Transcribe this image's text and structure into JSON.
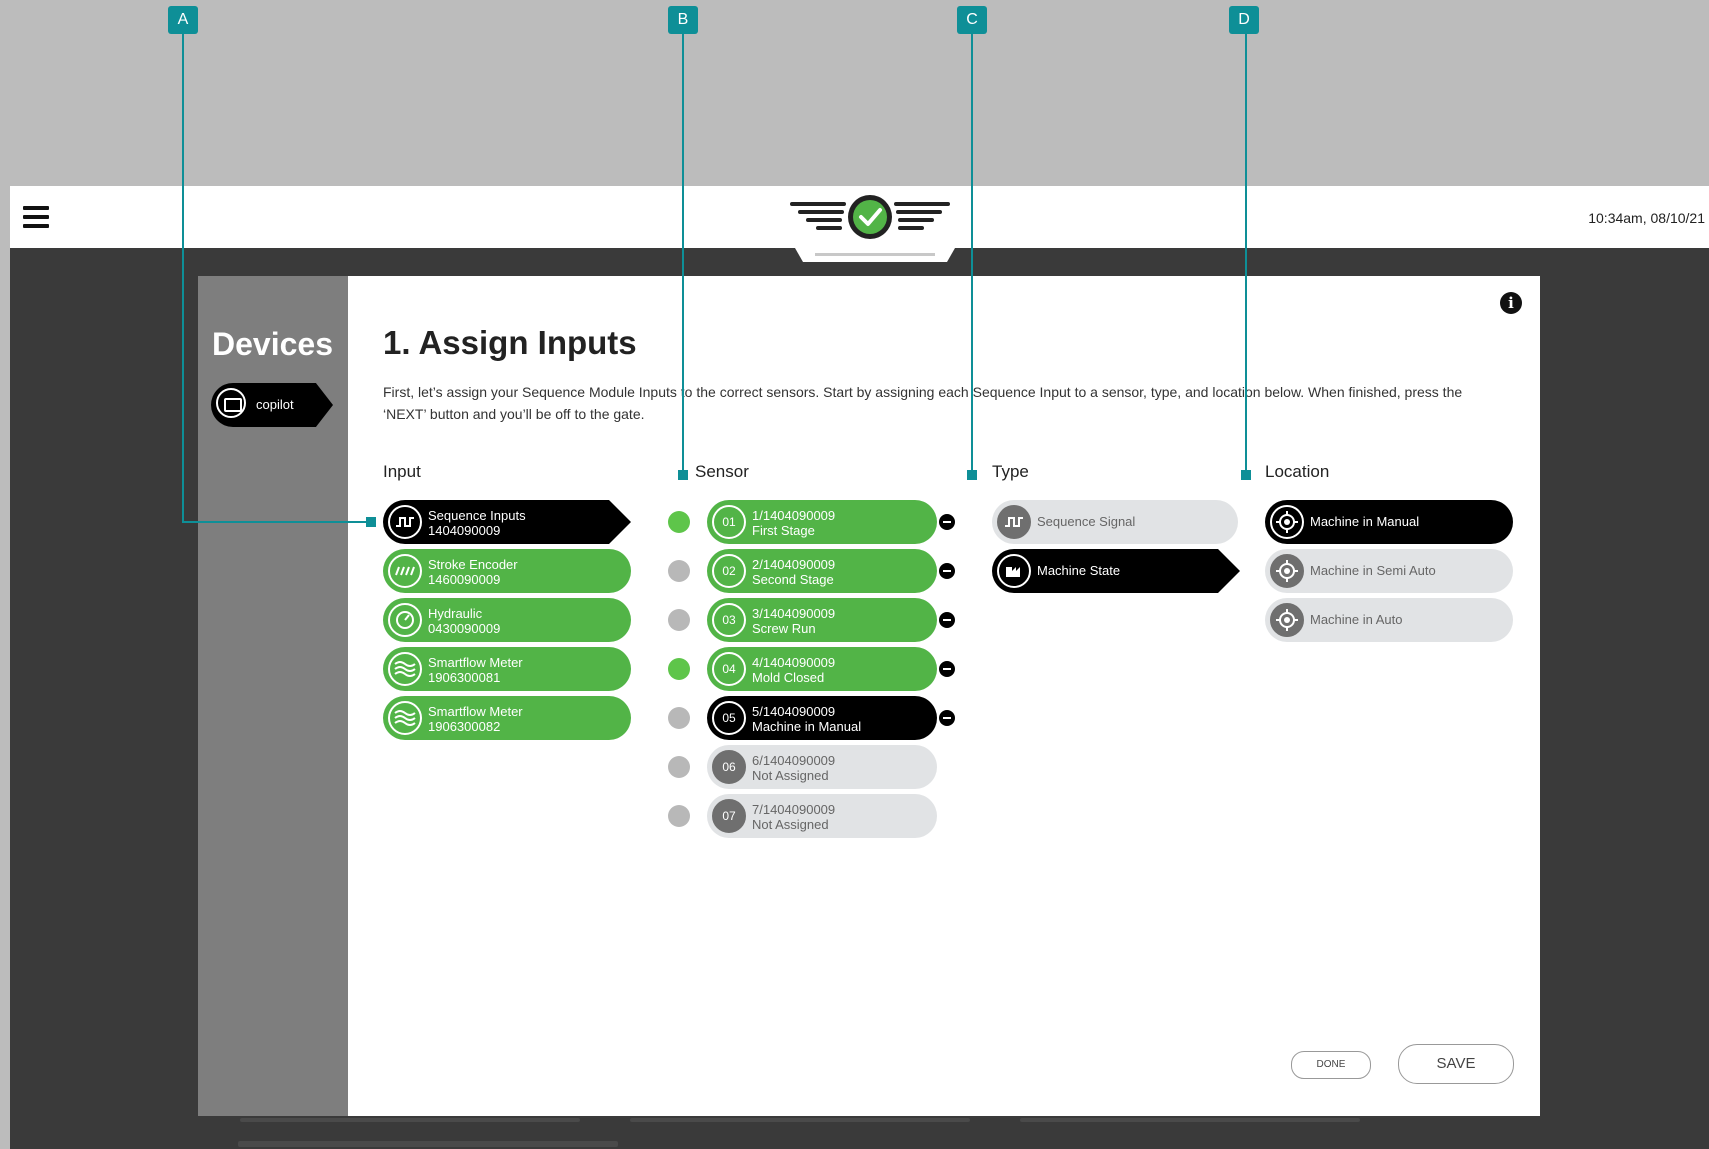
{
  "header": {
    "clock": "10:34am, 08/10/21"
  },
  "sidebar": {
    "title": "Devices",
    "device_label": "copilot"
  },
  "main": {
    "title": "1. Assign Inputs",
    "intro": "First, let’s assign your Sequence Module Inputs to the correct sensors. Start by assigning each Sequence Input to a sensor, type, and location below. When finished, press the ‘NEXT’ button and you’ll be off to the gate."
  },
  "columns": {
    "input": "Input",
    "sensor": "Sensor",
    "type": "Type",
    "location": "Location"
  },
  "inputs": [
    {
      "name": "Sequence Inputs",
      "serial": "1404090009",
      "icon": "square-wave-icon",
      "state": "selected"
    },
    {
      "name": "Stroke Encoder",
      "serial": "1460090009",
      "icon": "encoder-icon",
      "state": "assigned"
    },
    {
      "name": "Hydraulic",
      "serial": "0430090009",
      "icon": "gauge-icon",
      "state": "assigned"
    },
    {
      "name": "Smartflow Meter",
      "serial": "1906300081",
      "icon": "wave-icon",
      "state": "assigned"
    },
    {
      "name": "Smartflow Meter",
      "serial": "1906300082",
      "icon": "wave-icon",
      "state": "assigned"
    }
  ],
  "sensors": [
    {
      "num": "01",
      "id": "1/1404090009",
      "label": "First Stage",
      "state": "assigned",
      "indicator": "on"
    },
    {
      "num": "02",
      "id": "2/1404090009",
      "label": "Second Stage",
      "state": "assigned",
      "indicator": "off"
    },
    {
      "num": "03",
      "id": "3/1404090009",
      "label": "Screw Run",
      "state": "assigned",
      "indicator": "off"
    },
    {
      "num": "04",
      "id": "4/1404090009",
      "label": "Mold Closed",
      "state": "assigned",
      "indicator": "on"
    },
    {
      "num": "05",
      "id": "5/1404090009",
      "label": "Machine in Manual",
      "state": "selected",
      "indicator": "off"
    },
    {
      "num": "06",
      "id": "6/1404090009",
      "label": "Not Assigned",
      "state": "unassigned",
      "indicator": "off"
    },
    {
      "num": "07",
      "id": "7/1404090009",
      "label": "Not Assigned",
      "state": "unassigned",
      "indicator": "off"
    }
  ],
  "types": [
    {
      "label": "Sequence Signal",
      "icon": "square-wave-icon",
      "state": "inactive"
    },
    {
      "label": "Machine State",
      "icon": "machine-icon",
      "state": "selected"
    }
  ],
  "locations": [
    {
      "label": "Machine in Manual",
      "icon": "target-icon",
      "state": "selected"
    },
    {
      "label": "Machine in Semi Auto",
      "icon": "target-icon",
      "state": "inactive"
    },
    {
      "label": "Machine in Auto",
      "icon": "target-icon",
      "state": "inactive"
    }
  ],
  "buttons": {
    "done": "DONE",
    "save": "SAVE"
  },
  "callouts": [
    "A",
    "B",
    "C",
    "D"
  ],
  "colors": {
    "accent": "#52b447",
    "callout": "#0e8f97",
    "selected": "#000000",
    "inactive": "#e1e3e5"
  }
}
